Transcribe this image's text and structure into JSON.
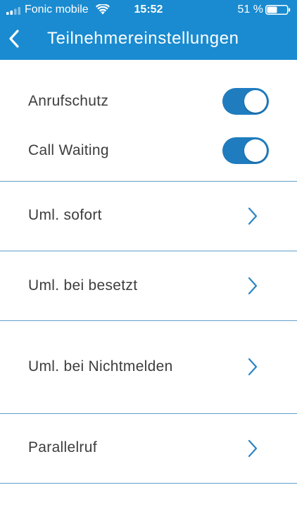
{
  "status_bar": {
    "carrier": "Fonic mobile",
    "time": "15:52",
    "battery_percent": "51 %",
    "battery_level": 0.51,
    "icons": [
      "cellular-signal-icon",
      "wifi-icon",
      "battery-icon"
    ]
  },
  "nav": {
    "title": "Teilnehmereinstellungen",
    "back_icon": "chevron-left-icon"
  },
  "toggles": [
    {
      "label": "Anrufschutz",
      "on": true
    },
    {
      "label": "Call Waiting",
      "on": true
    }
  ],
  "menu_items": [
    {
      "label": "Uml. sofort",
      "icon": "chevron-right-icon"
    },
    {
      "label": "Uml. bei besetzt",
      "icon": "chevron-right-icon"
    },
    {
      "label": "Uml. bei Nichtmelden",
      "icon": "chevron-right-icon"
    },
    {
      "label": "Parallelruf",
      "icon": "chevron-right-icon"
    }
  ],
  "colors": {
    "header_background": "#1a8bd0",
    "toggle_on": "#1f7cbf",
    "divider": "#2a7fb6",
    "chevron": "#2a86c4",
    "text": "#3d3d3d"
  }
}
